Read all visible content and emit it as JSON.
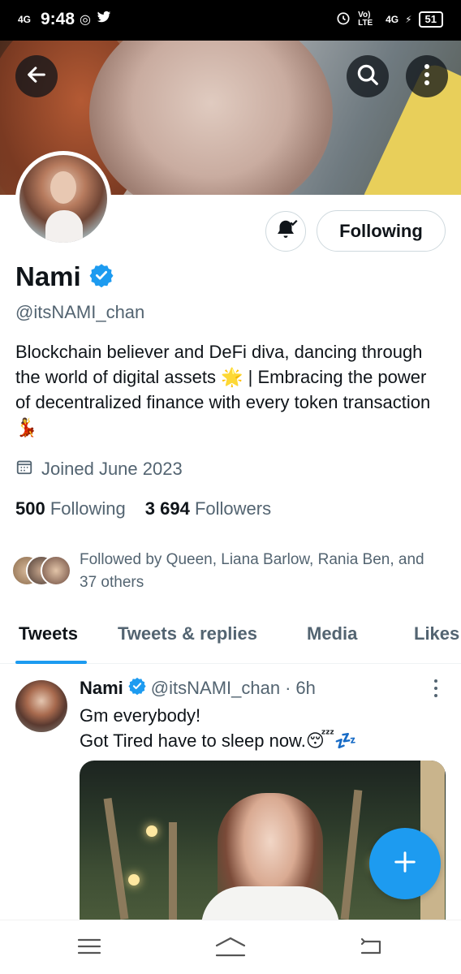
{
  "status_bar": {
    "network": "4G",
    "time": "9:48",
    "volte": "Vo) LTE",
    "network_right": "4G",
    "battery": "51"
  },
  "header": {
    "back_icon": "arrow-left-icon",
    "search_icon": "search-icon",
    "more_icon": "more-vertical-icon"
  },
  "profile": {
    "display_name": "Nami",
    "handle": "@itsNAMI_chan",
    "bio": "Blockchain believer and DeFi diva, dancing through the world of digital assets 🌟 | Embracing the power of decentralized finance with every token transaction 💃",
    "joined": "Joined June 2023",
    "following_count": "500",
    "following_label": "Following",
    "followers_count": "3 694",
    "followers_label": "Followers",
    "followed_by": "Followed by Queen, Liana Barlow, Rania Ben, and 37 others",
    "follow_button_label": "Following",
    "verified_color": "#1d9bf0"
  },
  "tabs": [
    {
      "label": "Tweets",
      "active": true
    },
    {
      "label": "Tweets & replies",
      "active": false
    },
    {
      "label": "Media",
      "active": false
    },
    {
      "label": "Likes",
      "active": false
    }
  ],
  "tweet": {
    "author_name": "Nami",
    "author_handle": "@itsNAMI_chan",
    "time": "6h",
    "text_line1": "Gm everybody!",
    "text_line2": "Got Tired have to sleep now.😴💤"
  },
  "colors": {
    "accent": "#1d9bf0",
    "text_primary": "#0f1419",
    "text_secondary": "#536471"
  }
}
